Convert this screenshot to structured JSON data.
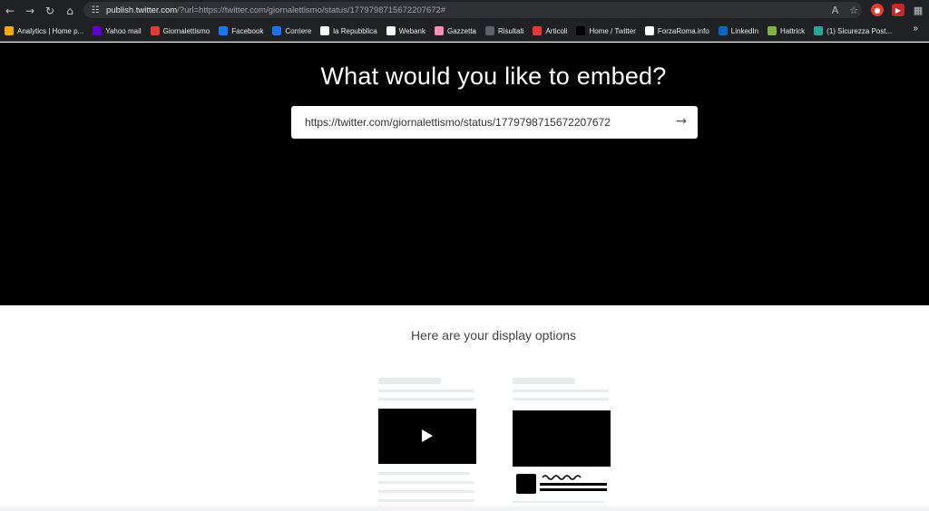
{
  "browser": {
    "url_host": "publish.twitter.com",
    "url_rest": "/?url=https://twitter.com/giornalettismo/status/1779798715672207672#",
    "bookmarks": [
      {
        "label": "Analytics | Home p...",
        "icon": "analytics-icon",
        "color": "#f9ab00"
      },
      {
        "label": "Yahoo mail",
        "icon": "yahoo-icon",
        "color": "#6001d2"
      },
      {
        "label": "Giornalettismo",
        "icon": "giornalettismo-icon",
        "color": "#e53935"
      },
      {
        "label": "Facebook",
        "icon": "facebook-icon",
        "color": "#1877f2"
      },
      {
        "label": "Corriere",
        "icon": "corriere-icon",
        "color": "#1a73e8"
      },
      {
        "label": "la Repubblica",
        "icon": "repubblica-icon",
        "color": "#ffffff"
      },
      {
        "label": "Webank",
        "icon": "webank-icon",
        "color": "#ffffff"
      },
      {
        "label": "Gazzetta",
        "icon": "gazzetta-icon",
        "color": "#f48fb1"
      },
      {
        "label": "Risultati",
        "icon": "risultati-icon",
        "color": "#5f6368"
      },
      {
        "label": "Articoli",
        "icon": "articoli-icon",
        "color": "#e53935"
      },
      {
        "label": "Home / Twitter",
        "icon": "x-icon",
        "color": "#000000"
      },
      {
        "label": "ForzaRoma.info",
        "icon": "forzaroma-icon",
        "color": "#ffffff"
      },
      {
        "label": "LinkedIn",
        "icon": "linkedin-icon",
        "color": "#0a66c2"
      },
      {
        "label": "Hattrick",
        "icon": "hattrick-icon",
        "color": "#7cb342"
      },
      {
        "label": "(1) Sicurezza Post...",
        "icon": "sicurezza-icon",
        "color": "#26a69a"
      }
    ]
  },
  "page": {
    "hero_title": "What would you like to embed?",
    "embed_value": "https://twitter.com/giornalettismo/status/1779798715672207672",
    "options_title": "Here are your display options"
  },
  "colors": {
    "hero_bg": "#000000",
    "chrome_bg": "#202124"
  }
}
